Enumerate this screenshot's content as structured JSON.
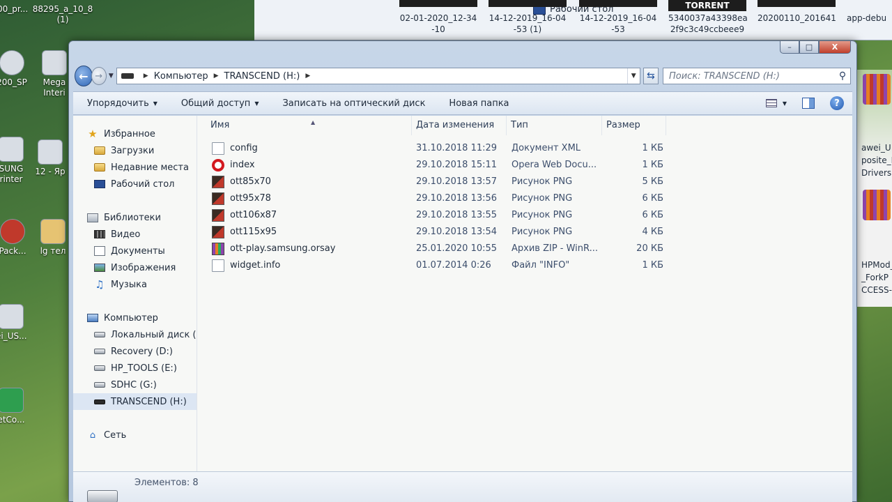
{
  "desktop": {
    "icons": [
      {
        "label": "88295_a_10_8\n(1)"
      },
      {
        "label": "00_pr..."
      },
      {
        "label": "200_SP"
      },
      {
        "label": "Mega\nInteri"
      },
      {
        "label": "SUNG\nrinter"
      },
      {
        "label": "12 - Яр"
      },
      {
        "label": "Pack..."
      },
      {
        "label": "lg тел"
      },
      {
        "label": "ei_US..."
      },
      {
        "label": "etCo..."
      }
    ],
    "bg_window": {
      "nav_item": "Рабочий стол",
      "thumbs": [
        {
          "label": "02-01-2020_12-34\n-10"
        },
        {
          "label": "14-12-2019_16-04\n-53 (1)"
        },
        {
          "label": "14-12-2019_16-04\n-53"
        },
        {
          "title": "TORRENT",
          "label": "5340037a43398ea\n2f9c3c49ccbeee9"
        },
        {
          "label": "20200110_201641"
        },
        {
          "label": "app-debu"
        }
      ]
    },
    "right_strip": {
      "lines_top": [
        "awei_U",
        "posite_D",
        "Drivers"
      ],
      "lines_bottom": [
        "HPMod_",
        "_ForkP",
        "CCESS-r"
      ]
    }
  },
  "window": {
    "caption_buttons": {
      "minimize": "–",
      "maximize": "□",
      "close": "X"
    },
    "address": {
      "breadcrumb": [
        "Компьютер",
        "TRANSCEND (H:)"
      ]
    },
    "search": {
      "placeholder": "Поиск: TRANSCEND (H:)"
    },
    "toolbar": {
      "organize": "Упорядочить",
      "share": "Общий доступ",
      "burn": "Записать на оптический диск",
      "new_folder": "Новая папка"
    },
    "nav_pane": {
      "favorites": {
        "title": "Избранное",
        "items": [
          "Загрузки",
          "Недавние места",
          "Рабочий стол"
        ]
      },
      "libraries": {
        "title": "Библиотеки",
        "items": [
          "Видео",
          "Документы",
          "Изображения",
          "Музыка"
        ]
      },
      "computer": {
        "title": "Компьютер",
        "items": [
          "Локальный диск (C",
          "Recovery (D:)",
          "HP_TOOLS (E:)",
          "SDHC (G:)",
          "TRANSCEND (H:)"
        ],
        "selected": "TRANSCEND (H:)"
      },
      "network": {
        "title": "Сеть"
      }
    },
    "columns": {
      "name": "Имя",
      "date": "Дата изменения",
      "type": "Тип",
      "size": "Размер"
    },
    "files": [
      {
        "name": "config",
        "date": "31.10.2018 11:29",
        "type": "Документ XML",
        "size": "1 КБ",
        "icon": "xml-doc-icon"
      },
      {
        "name": "index",
        "date": "29.10.2018 15:11",
        "type": "Opera Web Docu...",
        "size": "1 КБ",
        "icon": "opera-icon"
      },
      {
        "name": "ott85x70",
        "date": "29.10.2018 13:57",
        "type": "Рисунок PNG",
        "size": "5 КБ",
        "icon": "png-icon"
      },
      {
        "name": "ott95x78",
        "date": "29.10.2018 13:56",
        "type": "Рисунок PNG",
        "size": "6 КБ",
        "icon": "png-icon"
      },
      {
        "name": "ott106x87",
        "date": "29.10.2018 13:55",
        "type": "Рисунок PNG",
        "size": "6 КБ",
        "icon": "png-icon"
      },
      {
        "name": "ott115x95",
        "date": "29.10.2018 13:54",
        "type": "Рисунок PNG",
        "size": "4 КБ",
        "icon": "png-icon"
      },
      {
        "name": "ott-play.samsung.orsay",
        "date": "25.01.2020 10:55",
        "type": "Архив ZIP - WinR...",
        "size": "20 КБ",
        "icon": "winrar-icon"
      },
      {
        "name": "widget.info",
        "date": "01.07.2014 0:26",
        "type": "Файл \"INFO\"",
        "size": "1 КБ",
        "icon": "info-file-icon"
      }
    ],
    "status": {
      "count_text": "Элементов: 8"
    }
  }
}
